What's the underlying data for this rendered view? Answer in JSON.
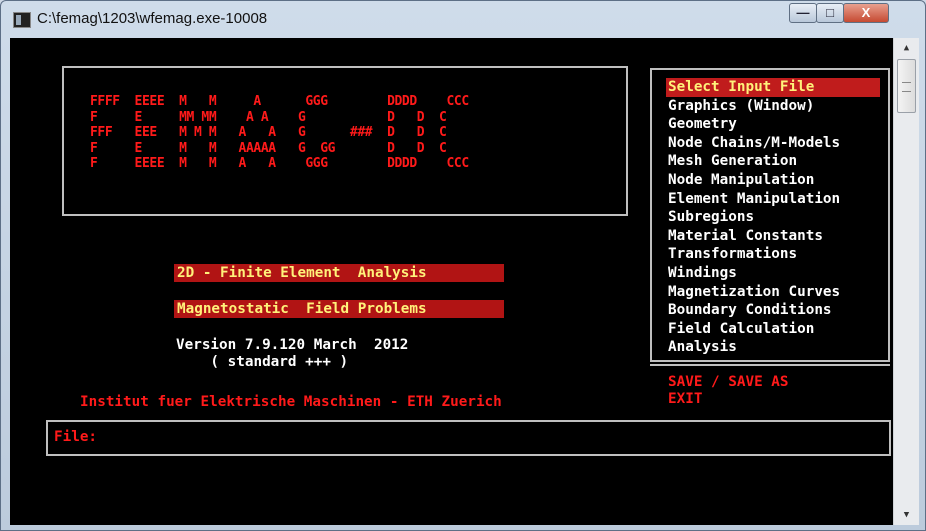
{
  "window": {
    "title": "C:\\femag\\1203\\wfemag.exe-10008"
  },
  "controls": {
    "minimize": "—",
    "maximize": "□",
    "close": "X"
  },
  "logo_lines": [
    "FFFF  EEEE  M   M     A      GGG        DDDD    CCC",
    "F     E     MM MM    A A    G           D   D  C",
    "FFF   EEE   M M M   A   A   G      ###  D   D  C",
    "F     E     M   M   AAAAA   G  GG       D   D  C",
    "F     EEEE  M   M   A   A    GGG        DDDD    CCC"
  ],
  "menu": {
    "items": [
      "Select Input File",
      "Graphics  (Window)",
      "Geometry",
      "Node Chains/M-Models",
      "Mesh Generation",
      "Node Manipulation",
      "Element Manipulation",
      "Subregions",
      "Material Constants",
      "Transformations",
      "Windings",
      "Magnetization Curves",
      "Boundary Conditions",
      "Field Calculation",
      "Analysis"
    ],
    "selected": "Select Input File",
    "bottom_items": [
      "SAVE / SAVE AS",
      "EXIT"
    ]
  },
  "headings": {
    "h1": "2D - Finite Element  Analysis",
    "h2": "Magnetostatic  Field Problems"
  },
  "version_lines": [
    "Version 7.9.120 March  2012",
    "    ( standard +++ )"
  ],
  "institute": "Institut fuer Elektrische Maschinen - ETH Zuerich",
  "file_prompt": "File:",
  "colors": {
    "accent_red": "#ff1a1a",
    "highlight_bg": "#b11414",
    "highlight_text": "#fff27a",
    "console_bg": "#000000"
  }
}
